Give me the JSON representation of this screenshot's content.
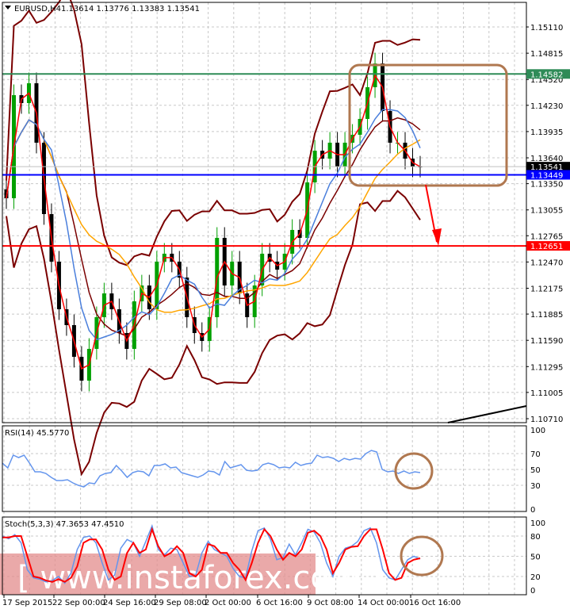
{
  "header": {
    "symbol": "EURUSD,H4",
    "ohlc": "1.13614 1.13776 1.13383 1.13541"
  },
  "watermark": "[ www.instaforex.com ]",
  "colors": {
    "bull": "#00a000",
    "bear": "#000000",
    "band": "#7a0000",
    "ma_fast": "#ff0000",
    "ma_mid": "#4a7fdc",
    "ma_slow": "#ffa500",
    "resistance": "#2e8b57",
    "support": "#0000ff",
    "target": "#ff0000",
    "annotation": "#b07850",
    "rsi": "#6495ed",
    "stoch_main": "#6495ed",
    "stoch_signal": "#ff0000"
  },
  "chart_data": [
    {
      "type": "candlestick",
      "title": "EURUSD,H4",
      "ylim": [
        1.106,
        1.154
      ],
      "y_ticks": [
        "1.15110",
        "1.14815",
        "1.14520",
        "1.14230",
        "1.13935",
        "1.13640",
        "1.13350",
        "1.13055",
        "1.12765",
        "1.12470",
        "1.12175",
        "1.11885",
        "1.11590",
        "1.11295",
        "1.11005",
        "1.10710"
      ],
      "x_ticks": [
        "17 Sep 2015",
        "22 Sep 00:00",
        "24 Sep 16:00",
        "29 Sep 08:00",
        "2 Oct 00:00",
        "6 Oct 16:00",
        "9 Oct 08:00",
        "14 Oct 00:00",
        "16 Oct 16:00"
      ],
      "grid": true,
      "close": [
        1.13186,
        1.14344,
        1.14255,
        1.14478,
        1.1381,
        1.13008,
        1.12474,
        1.11939,
        1.11761,
        1.11405,
        1.11137,
        1.11494,
        1.1185,
        1.12117,
        1.11939,
        1.11672,
        1.11494,
        1.12028,
        1.12206,
        1.11939,
        1.12474,
        1.12563,
        1.12474,
        1.12295,
        1.1185,
        1.11672,
        1.11583,
        1.1185,
        1.12741,
        1.12206,
        1.12474,
        1.12117,
        1.1185,
        1.12206,
        1.12563,
        1.12474,
        1.12384,
        1.12563,
        1.1283,
        1.12741,
        1.13364,
        1.1372,
        1.13631,
        1.1381,
        1.13542,
        1.1381,
        1.13899,
        1.14077,
        1.14433,
        1.147,
        1.14166,
        1.1381,
        1.1381,
        1.13631,
        1.13542,
        1.13541
      ],
      "levels": [
        {
          "name": "resistance",
          "value": "1.14582"
        },
        {
          "name": "current",
          "value": "1.13541"
        },
        {
          "name": "support",
          "value": "1.13449"
        },
        {
          "name": "target",
          "value": "1.12651"
        }
      ]
    },
    {
      "type": "line",
      "title": "RSI(14) 45.5770",
      "ylim": [
        0,
        100
      ],
      "y_ticks": [
        "100",
        "70",
        "50",
        "30",
        "0"
      ],
      "values": [
        58,
        52,
        68,
        65,
        68,
        58,
        47,
        47,
        45,
        40,
        36,
        36,
        37,
        33,
        30,
        28,
        33,
        32,
        42,
        45,
        46,
        55,
        48,
        40,
        46,
        48,
        47,
        42,
        55,
        55,
        57,
        52,
        53,
        46,
        44,
        42,
        40,
        43,
        48,
        47,
        43,
        60,
        52,
        54,
        56,
        49,
        48,
        49,
        56,
        58,
        56,
        52,
        53,
        52,
        59,
        55,
        57,
        58,
        68,
        65,
        66,
        64,
        60,
        64,
        62,
        64,
        63,
        70,
        74,
        72,
        50,
        47,
        48,
        45,
        48,
        45,
        47,
        46
      ]
    },
    {
      "type": "line",
      "title": "Stoch(5,3,3) 47.3653 47.4510",
      "ylim": [
        0,
        100
      ],
      "y_ticks": [
        "100",
        "80",
        "50",
        "20",
        "0"
      ],
      "series": [
        {
          "values": [
            80,
            76,
            82,
            70,
            30,
            18,
            16,
            12,
            14,
            20,
            10,
            25,
            60,
            78,
            80,
            70,
            40,
            15,
            22,
            62,
            75,
            70,
            50,
            72,
            95,
            60,
            52,
            62,
            60,
            40,
            20,
            22,
            55,
            72,
            60,
            55,
            50,
            32,
            20,
            18,
            58,
            88,
            92,
            75,
            45,
            48,
            68,
            52,
            70,
            90,
            86,
            70,
            40,
            20,
            50,
            62,
            65,
            72,
            88,
            92,
            70,
            30,
            18,
            15,
            30,
            45,
            50,
            46
          ]
        },
        {
          "values": [
            78,
            78,
            80,
            80,
            50,
            20,
            18,
            14,
            12,
            16,
            12,
            18,
            35,
            70,
            75,
            75,
            60,
            30,
            15,
            20,
            55,
            70,
            55,
            60,
            90,
            65,
            50,
            55,
            65,
            55,
            25,
            20,
            30,
            68,
            65,
            55,
            55,
            40,
            30,
            15,
            40,
            70,
            90,
            80,
            60,
            45,
            55,
            50,
            60,
            85,
            88,
            80,
            60,
            25,
            40,
            60,
            64,
            65,
            80,
            90,
            90,
            60,
            25,
            15,
            18,
            40,
            45,
            47
          ]
        }
      ]
    }
  ]
}
